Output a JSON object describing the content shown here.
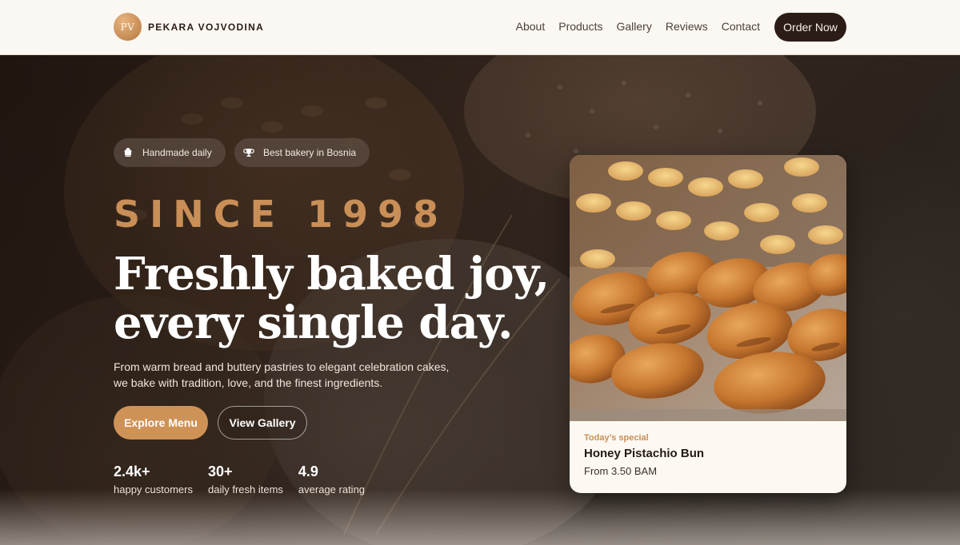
{
  "brand": {
    "logo_text": "PV",
    "name": "PEKARA VOJVODINA"
  },
  "nav": {
    "links": [
      "About",
      "Products",
      "Gallery",
      "Reviews",
      "Contact"
    ],
    "cta": "Order Now"
  },
  "hero": {
    "badges": [
      {
        "icon": "chef-hat-icon",
        "label": "Handmade daily"
      },
      {
        "icon": "trophy-icon",
        "label": "Best bakery in Bosnia"
      }
    ],
    "eyebrow": "SINCE 1998",
    "headline_line1": "Freshly baked joy,",
    "headline_line2": "every single day.",
    "lead": "From warm bread and buttery pastries to elegant celebration cakes, we bake with tradition, love, and the finest ingredients.",
    "primary_button": "Explore Menu",
    "secondary_button": "View Gallery",
    "stats": [
      {
        "value": "2.4k+",
        "label": "happy customers"
      },
      {
        "value": "30+",
        "label": "daily fresh items"
      },
      {
        "value": "4.9",
        "label": "average rating"
      }
    ]
  },
  "special_card": {
    "tag": "Today’s special",
    "title": "Honey Pistachio Bun",
    "price": "From 3.50 BAM"
  },
  "colors": {
    "accent": "#cf9256",
    "dark": "#2b1d16",
    "nav_bg": "#fbf7f2"
  }
}
